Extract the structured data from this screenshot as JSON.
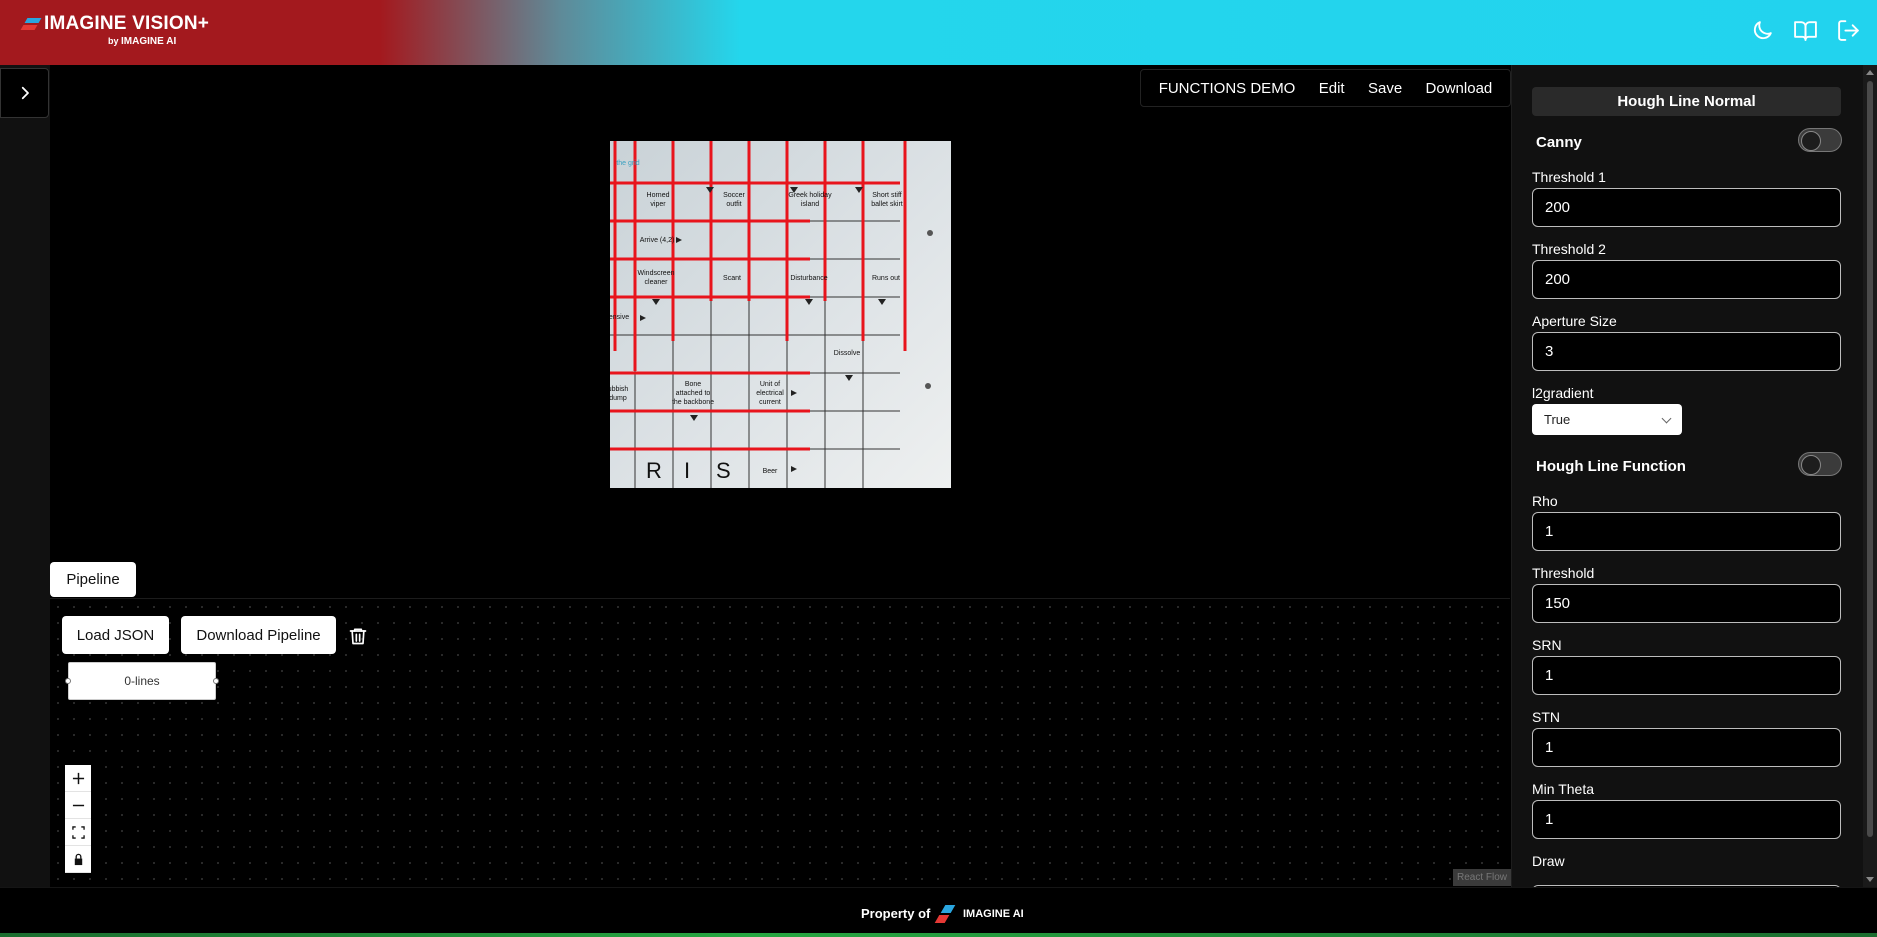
{
  "header": {
    "brand": "IMAGINE VISION+",
    "brand_sub_prefix": "by",
    "brand_sub": "IMAGINE AI",
    "icons": [
      "moon-icon",
      "book-icon",
      "logout-icon"
    ]
  },
  "topmenu": {
    "items": [
      "FUNCTIONS DEMO",
      "Edit",
      "Save",
      "Download"
    ]
  },
  "canvas": {
    "image_labels": [
      "the grid",
      "Horned viper",
      "Soccer outfit",
      "Greek holiday island",
      "Short stiff ballet skirt",
      "Arrive (4,2)",
      "Windscreen cleaner",
      "Scant",
      "Disturbance",
      "Runs out",
      "ensive",
      "Dissolve",
      "ubbish dump",
      "Bone attached to the backbone",
      "Unit of electrical current",
      "Beer",
      "R",
      "I",
      "S"
    ]
  },
  "pipeline": {
    "tab_label": "Pipeline",
    "load_json_label": "Load JSON",
    "download_pipeline_label": "Download Pipeline",
    "node_label": "0-lines",
    "attribution": "React Flow"
  },
  "panel": {
    "title": "Hough Line Normal",
    "canny": {
      "title": "Canny",
      "enabled": false,
      "threshold1_label": "Threshold 1",
      "threshold1_value": "200",
      "threshold2_label": "Threshold 2",
      "threshold2_value": "200",
      "aperture_label": "Aperture Size",
      "aperture_value": "3",
      "l2gradient_label": "l2gradient",
      "l2gradient_value": "True"
    },
    "hough": {
      "title": "Hough Line Function",
      "enabled": false,
      "rho_label": "Rho",
      "rho_value": "1",
      "threshold_label": "Threshold",
      "threshold_value": "150",
      "srn_label": "SRN",
      "srn_value": "1",
      "stn_label": "STN",
      "stn_value": "1",
      "min_theta_label": "Min Theta",
      "min_theta_value": "1",
      "draw_label": "Draw"
    }
  },
  "footer": {
    "property_of": "Property of",
    "brand": "IMAGINE AI"
  },
  "colors": {
    "header_left": "#a3191e",
    "header_right": "#22d3ee",
    "line_red": "#e8141c"
  }
}
